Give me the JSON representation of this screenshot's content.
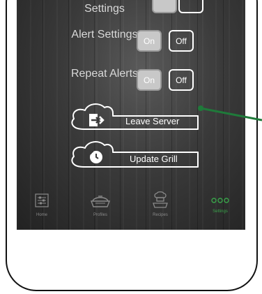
{
  "settings_rows": [
    {
      "label": "Settings",
      "on": "",
      "off": ""
    },
    {
      "label": "Alert Settings",
      "on": "On",
      "off": "Off"
    },
    {
      "label": "Repeat Alerts",
      "on": "On",
      "off": "Off"
    }
  ],
  "actions": {
    "leave_server": "Leave Server",
    "update_grill": "Update Grill"
  },
  "tabs": [
    {
      "label": "Home",
      "icon": "home-sliders-icon"
    },
    {
      "label": "Profiles",
      "icon": "grill-icon"
    },
    {
      "label": "Recipes",
      "icon": "chef-icon"
    },
    {
      "label": "Settings",
      "icon": "more-icon"
    }
  ],
  "colors": {
    "active_tab": "#39a34a",
    "callout": "#1f7a3a"
  }
}
